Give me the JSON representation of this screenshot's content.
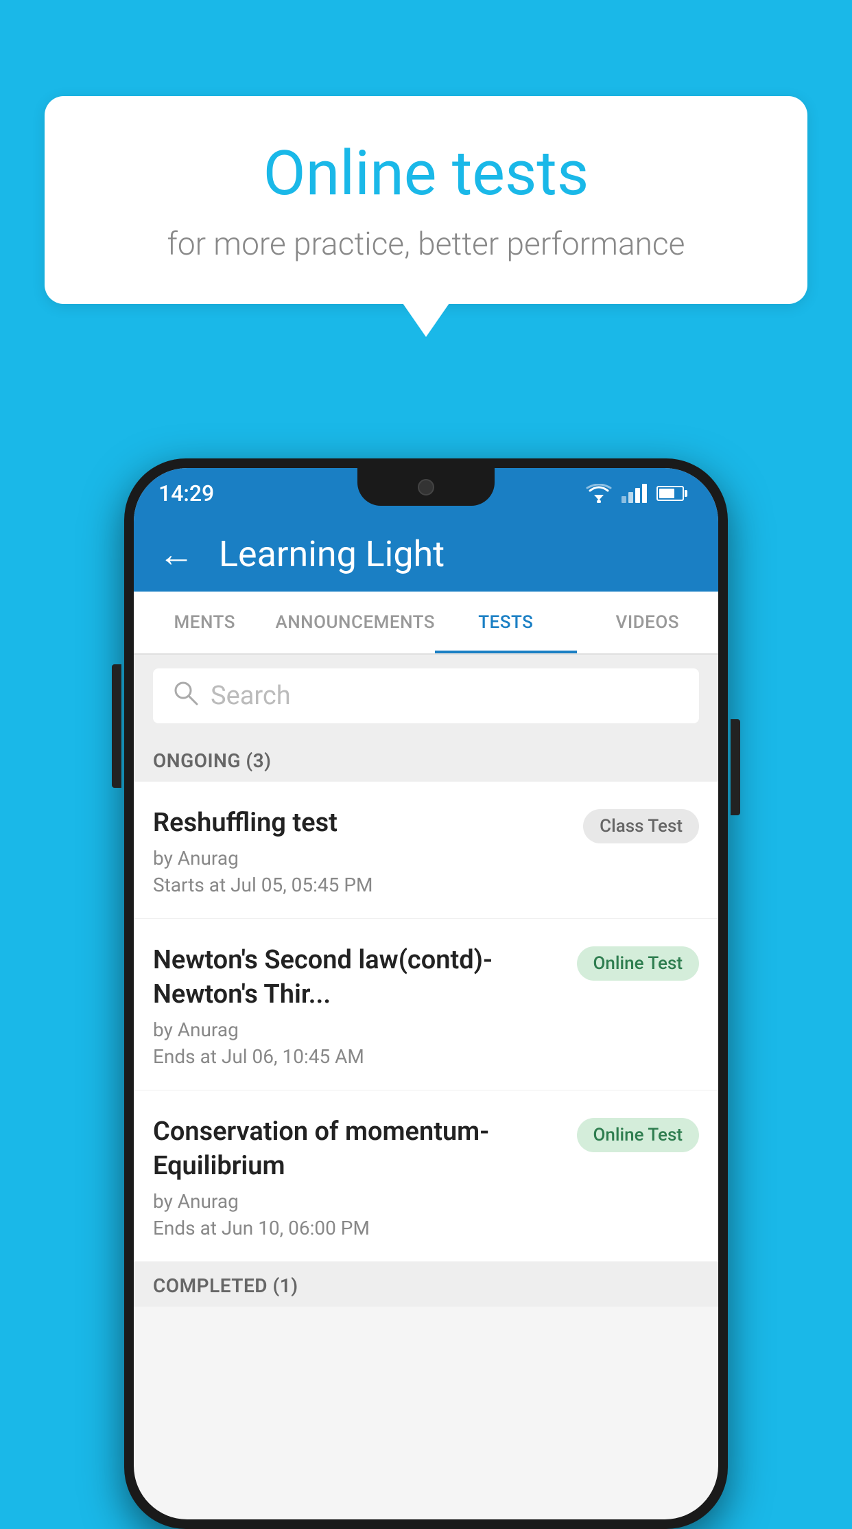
{
  "background_color": "#1ab8e8",
  "speech_bubble": {
    "title": "Online tests",
    "subtitle": "for more practice, better performance"
  },
  "phone": {
    "status_bar": {
      "time": "14:29"
    },
    "header": {
      "title": "Learning Light",
      "back_label": "←"
    },
    "tabs": [
      {
        "label": "MENTS",
        "active": false
      },
      {
        "label": "ANNOUNCEMENTS",
        "active": false
      },
      {
        "label": "TESTS",
        "active": true
      },
      {
        "label": "VIDEOS",
        "active": false
      }
    ],
    "search": {
      "placeholder": "Search"
    },
    "sections": [
      {
        "title": "ONGOING (3)",
        "tests": [
          {
            "title": "Reshuffling test",
            "by": "by Anurag",
            "date": "Starts at  Jul 05, 05:45 PM",
            "badge": "Class Test",
            "badge_type": "class"
          },
          {
            "title": "Newton's Second law(contd)-Newton's Thir...",
            "by": "by Anurag",
            "date": "Ends at  Jul 06, 10:45 AM",
            "badge": "Online Test",
            "badge_type": "online"
          },
          {
            "title": "Conservation of momentum-Equilibrium",
            "by": "by Anurag",
            "date": "Ends at  Jun 10, 06:00 PM",
            "badge": "Online Test",
            "badge_type": "online"
          }
        ]
      }
    ],
    "completed_section_label": "COMPLETED (1)"
  }
}
